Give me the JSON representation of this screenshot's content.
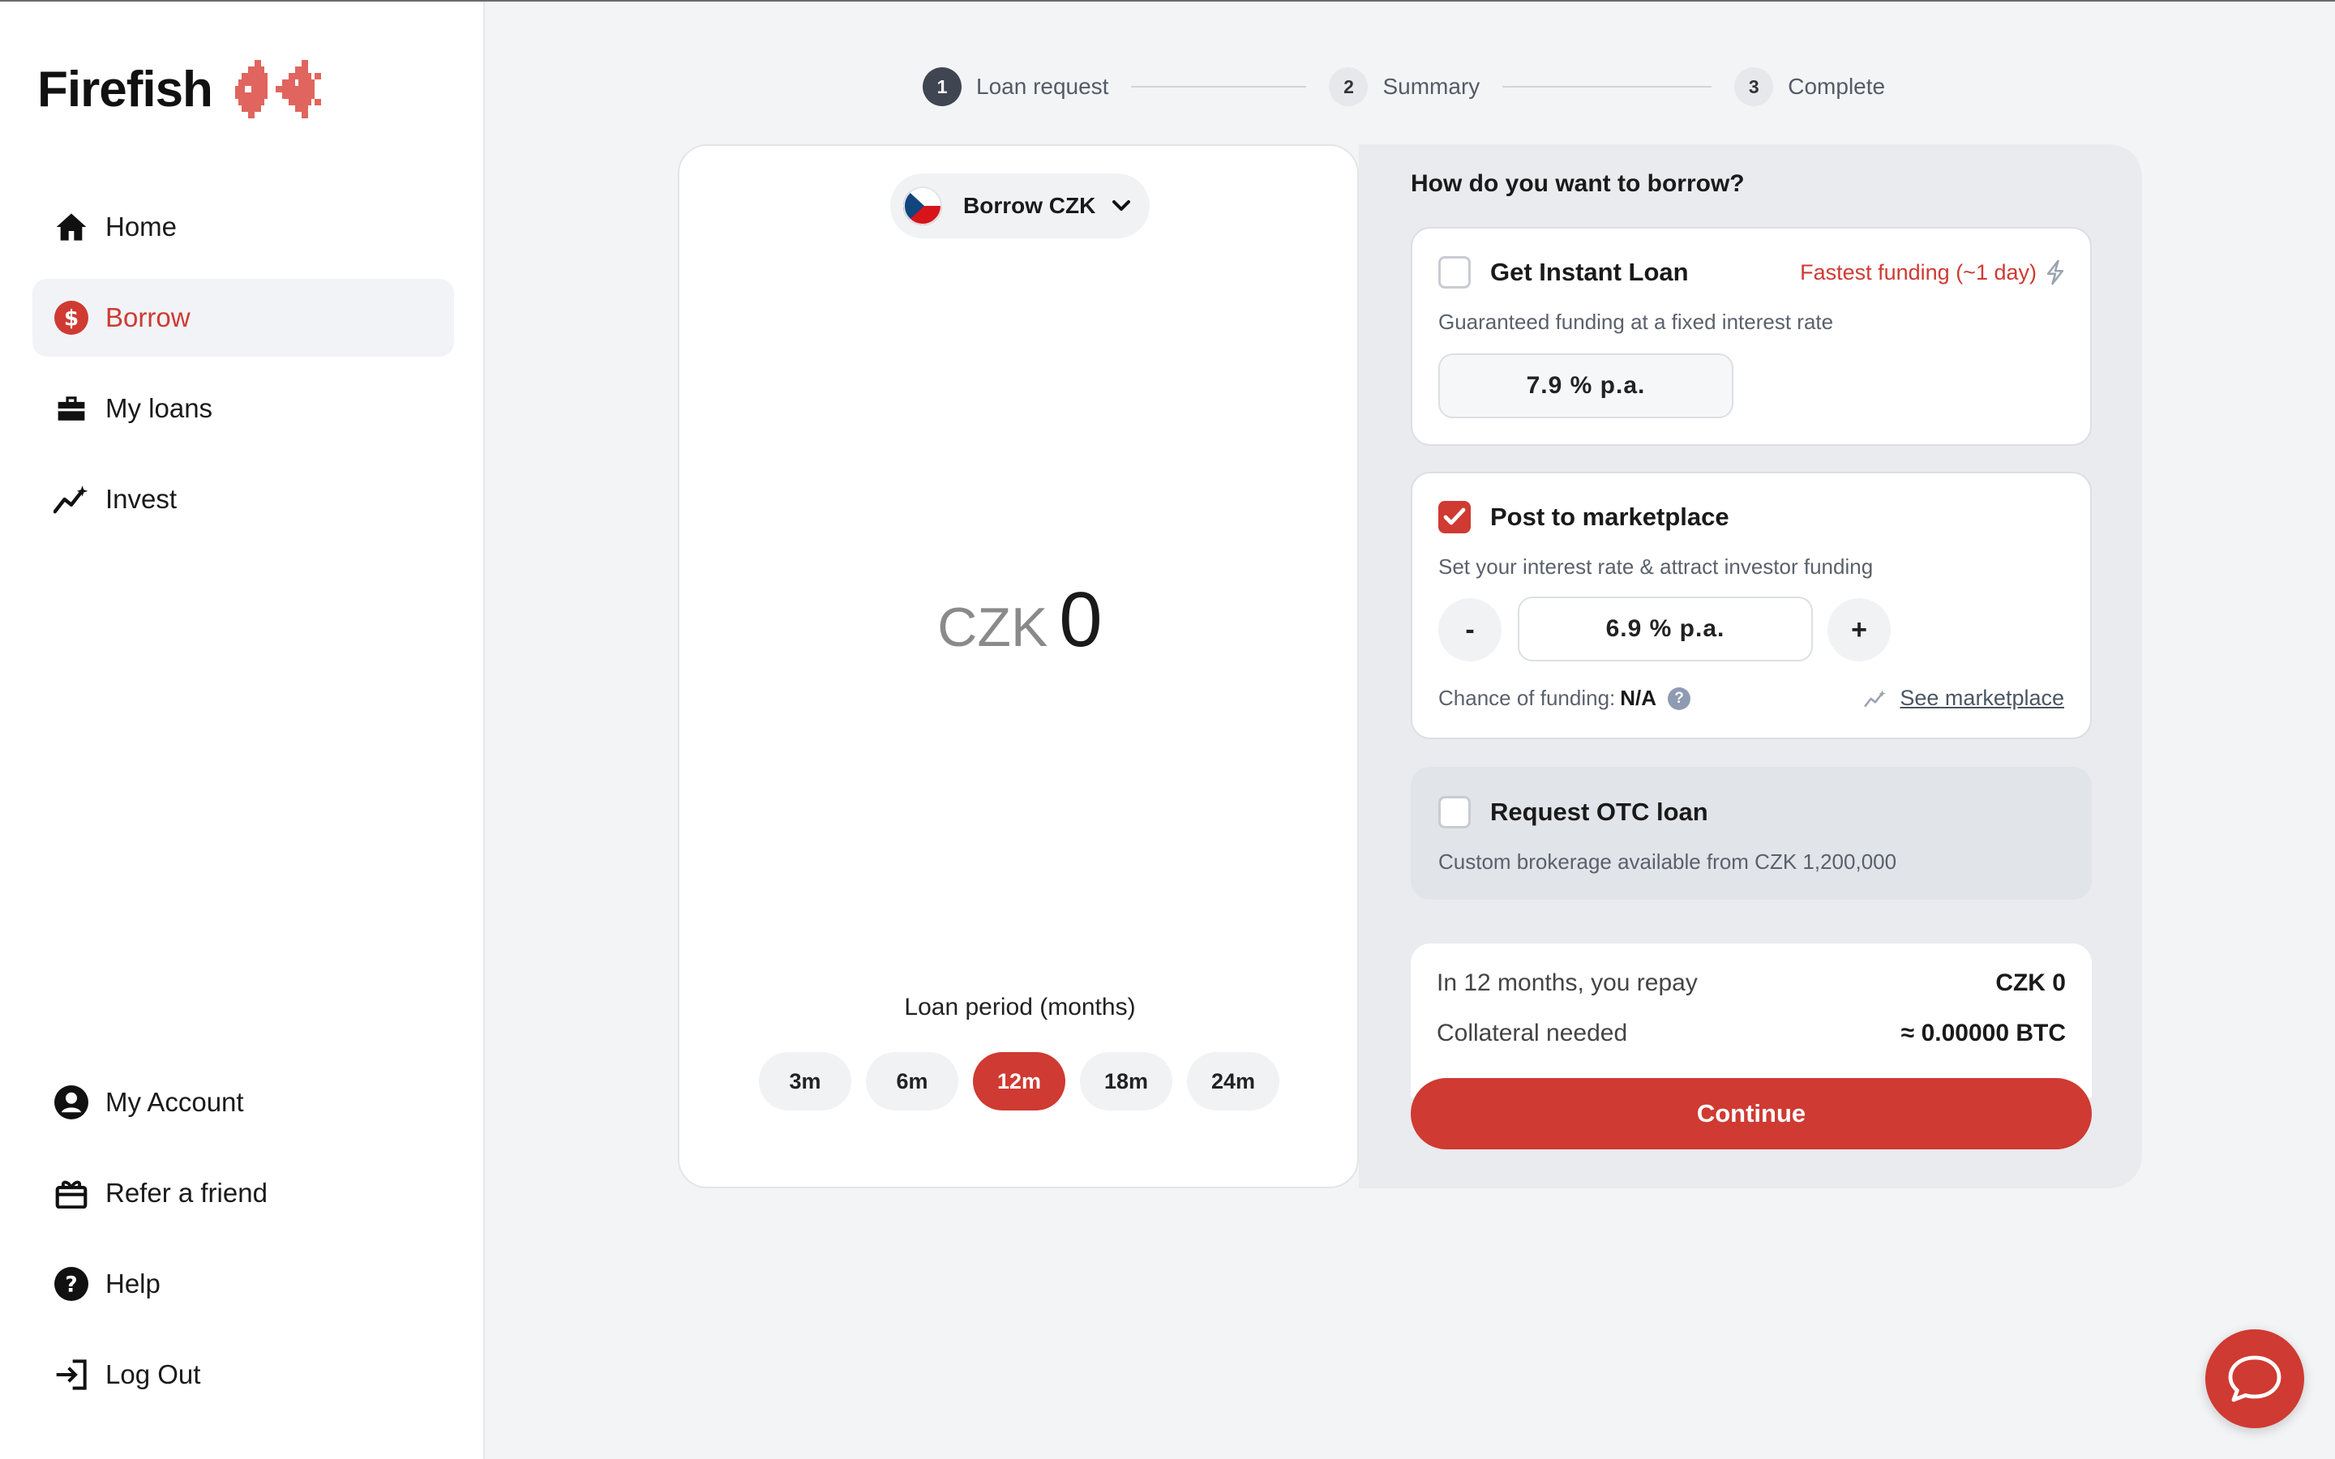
{
  "brand": {
    "name": "Firefish",
    "accent": "#cf3a32"
  },
  "sidebar": {
    "items": [
      {
        "label": "Home",
        "icon": "home-icon"
      },
      {
        "label": "Borrow",
        "icon": "dollar-circle-icon",
        "active": true
      },
      {
        "label": "My loans",
        "icon": "briefcase-icon"
      },
      {
        "label": "Invest",
        "icon": "sparkle-chart-icon"
      }
    ],
    "bottom_items": [
      {
        "label": "My Account",
        "icon": "user-circle-icon"
      },
      {
        "label": "Refer a friend",
        "icon": "gift-icon"
      },
      {
        "label": "Help",
        "icon": "question-circle-icon"
      },
      {
        "label": "Log Out",
        "icon": "logout-icon"
      }
    ]
  },
  "stepper": {
    "steps": [
      {
        "number": "1",
        "label": "Loan request",
        "state": "current"
      },
      {
        "number": "2",
        "label": "Summary",
        "state": "pending"
      },
      {
        "number": "3",
        "label": "Complete",
        "state": "pending"
      }
    ]
  },
  "amount_card": {
    "currency_select": "Borrow CZK",
    "currency": "CZK",
    "amount": "0",
    "period_title": "Loan period (months)",
    "periods": [
      "3m",
      "6m",
      "12m",
      "18m",
      "24m"
    ],
    "selected_period": "12m"
  },
  "options": {
    "title": "How do you want to borrow?",
    "instant": {
      "title": "Get Instant Loan",
      "badge": "Fastest funding (~1 day)",
      "description": "Guaranteed funding at a fixed interest rate",
      "rate": "7.9 % p.a.",
      "checked": false
    },
    "marketplace": {
      "title": "Post to marketplace",
      "description": "Set your interest rate & attract investor funding",
      "rate": "6.9 % p.a.",
      "minus": "-",
      "plus": "+",
      "chance_label": "Chance of funding:",
      "chance_value": "N/A",
      "help": "?",
      "see_marketplace": "See marketplace",
      "checked": true
    },
    "otc": {
      "title": "Request OTC loan",
      "description": "Custom brokerage available from CZK 1,200,000",
      "checked": false
    }
  },
  "summary": {
    "repay_label": "In 12 months, you repay",
    "repay_value": "CZK 0",
    "collateral_label": "Collateral needed",
    "collateral_value": "≈ 0.00000 BTC",
    "continue": "Continue"
  }
}
